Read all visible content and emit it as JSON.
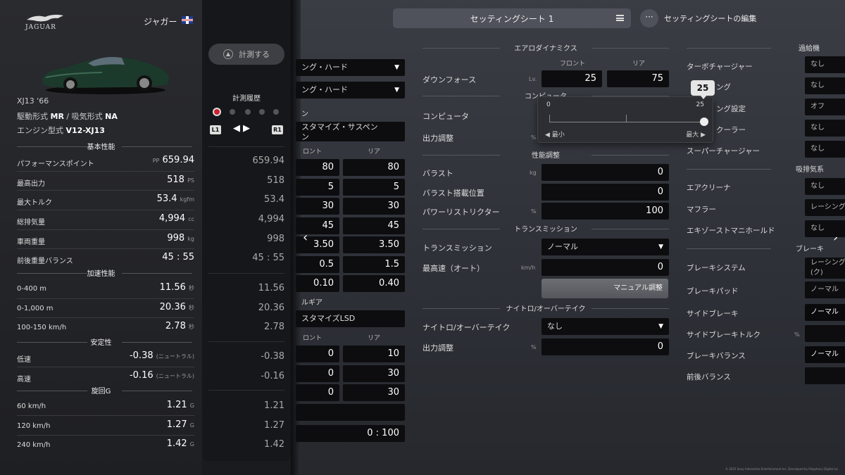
{
  "header": {
    "sheet_title": "セッティングシート 1",
    "edit_label": "セッティングシートの編集"
  },
  "car": {
    "logo_text": "JAGUAR",
    "maker": "ジャガー",
    "model": "XJ13 '66",
    "drivetrain_label": "駆動形式",
    "drivetrain": "MR",
    "intake_label": "吸気形式",
    "intake": "NA",
    "engine_label": "エンジン型式",
    "engine": "V12-XJ13"
  },
  "sections": {
    "basic": "基本性能",
    "accel": "加速性能",
    "stability": "安定性",
    "cornering": "旋回G"
  },
  "stats": {
    "pp": {
      "label": "パフォーマンスポイント",
      "prefix": "PP",
      "value": "659.94",
      "hist": "659.94"
    },
    "power": {
      "label": "最高出力",
      "value": "518",
      "unit": "PS",
      "hist": "518"
    },
    "torque": {
      "label": "最大トルク",
      "value": "53.4",
      "unit": "kgfm",
      "hist": "53.4"
    },
    "displacement": {
      "label": "総排気量",
      "value": "4,994",
      "unit": "cc",
      "hist": "4,994"
    },
    "weight": {
      "label": "車両重量",
      "value": "998",
      "unit": "kg",
      "hist": "998"
    },
    "balance": {
      "label": "前後重量バランス",
      "value": "45 : 55",
      "hist": "45 : 55"
    },
    "a0400": {
      "label": "0-400 m",
      "value": "11.56",
      "unit": "秒",
      "hist": "11.56"
    },
    "a01000": {
      "label": "0-1,000 m",
      "value": "20.36",
      "unit": "秒",
      "hist": "20.36"
    },
    "a100150": {
      "label": "100-150 km/h",
      "value": "2.78",
      "unit": "秒",
      "hist": "2.78"
    },
    "low": {
      "label": "低速",
      "value": "-0.38",
      "unit": "(ニュートラル)",
      "hist": "-0.38"
    },
    "high": {
      "label": "高速",
      "value": "-0.16",
      "unit": "(ニュートラル)",
      "hist": "-0.16"
    },
    "g60": {
      "label": "60 km/h",
      "value": "1.21",
      "unit": "G",
      "hist": "1.21"
    },
    "g120": {
      "label": "120 km/h",
      "value": "1.27",
      "unit": "G",
      "hist": "1.27"
    },
    "g240": {
      "label": "240 km/h",
      "value": "1.42",
      "unit": "G",
      "hist": "1.42"
    }
  },
  "history": {
    "measure_button": "計測する",
    "title": "計測履歴",
    "l1": "L1",
    "r1": "R1"
  },
  "suspension": {
    "tire_front": "ング・ハード",
    "tire_rear": "ング・ハード",
    "section": "ン",
    "type": "スタマイズ・サスペン",
    "type2": "ン",
    "front_label": "ロント",
    "rear_label": "リア",
    "rows": [
      [
        "80",
        "80"
      ],
      [
        "5",
        "5"
      ],
      [
        "30",
        "30"
      ],
      [
        "45",
        "45"
      ],
      [
        "3.50",
        "3.50"
      ],
      [
        "0.5",
        "1.5"
      ],
      [
        "0.10",
        "0.40"
      ]
    ],
    "diff_section": "ルギア",
    "diff_type": "スタマイズLSD",
    "diff_front_label": "ロント",
    "diff_rear_label": "リア",
    "diff_rows": [
      [
        "0",
        "10"
      ],
      [
        "0",
        "30"
      ],
      [
        "0",
        "30"
      ]
    ],
    "torque_split": "0 : 100"
  },
  "aero": {
    "section": "エアロダイナミクス",
    "front_label": "フロント",
    "rear_label": "リア",
    "downforce_label": "ダウンフォース",
    "unit": "Lv.",
    "front": "25",
    "rear": "75"
  },
  "ecu": {
    "section": "コンピュータ",
    "computer_label": "コンピュータ",
    "output_label": "出力調整",
    "output_unit": "%"
  },
  "popup": {
    "bubble": "25",
    "min": "0",
    "max": "25",
    "min_label": "最小",
    "max_label": "最大",
    "value": 25,
    "range": [
      0,
      25
    ]
  },
  "perf": {
    "section": "性能調整",
    "ballast_label": "バラスト",
    "ballast_unit": "kg",
    "ballast": "0",
    "ballast_pos_label": "バラスト搭載位置",
    "ballast_pos": "0",
    "restrictor_label": "パワーリストリクター",
    "restrictor_unit": "%",
    "restrictor": "100"
  },
  "transmission": {
    "section": "トランスミッション",
    "label": "トランスミッション",
    "value": "ノーマル",
    "top_speed_label": "最高速（オート）",
    "top_speed_unit": "km/h",
    "top_speed": "0",
    "manual_button": "マニュアル調整"
  },
  "nitro": {
    "section": "ナイトロ/オーバーテイク",
    "label": "ナイトロ/オーバーテイク",
    "value": "なし",
    "output_label": "出力調整",
    "output_unit": "%",
    "output": "0"
  },
  "supercharger": {
    "section": "過給機",
    "turbo_label": "ターボチャージャー",
    "turbo": "なし",
    "r2_label": "ング",
    "r2": "なし",
    "r3_label": "ング設定",
    "r3": "オフ",
    "r4_label": "クーラー",
    "r4": "なし",
    "super_label": "スーパーチャージャー",
    "super": "なし"
  },
  "exhaust": {
    "section": "吸排気系",
    "air_label": "エアクリーナ",
    "air": "なし",
    "muffler_label": "マフラー",
    "muffler": "レーシング",
    "manifold_label": "エキゾーストマニホールド",
    "manifold": "なし"
  },
  "brake": {
    "section": "ブレーキ",
    "system_label": "ブレーキシステム",
    "system": "レーシング(ク)",
    "pad_label": "ブレーキパッド",
    "pad": "ノーマル",
    "side_label": "サイドブレーキ",
    "side": "ノーマル",
    "side_torque_label": "サイドブレーキトルク",
    "side_torque_unit": "%",
    "balance_label": "ブレーキバランス",
    "balance": "ノーマル",
    "fr_label": "前後バランス"
  },
  "copyright": "© 2025 Sony Interactive Entertainment Inc. Developed by Polyphony Digital Inc."
}
